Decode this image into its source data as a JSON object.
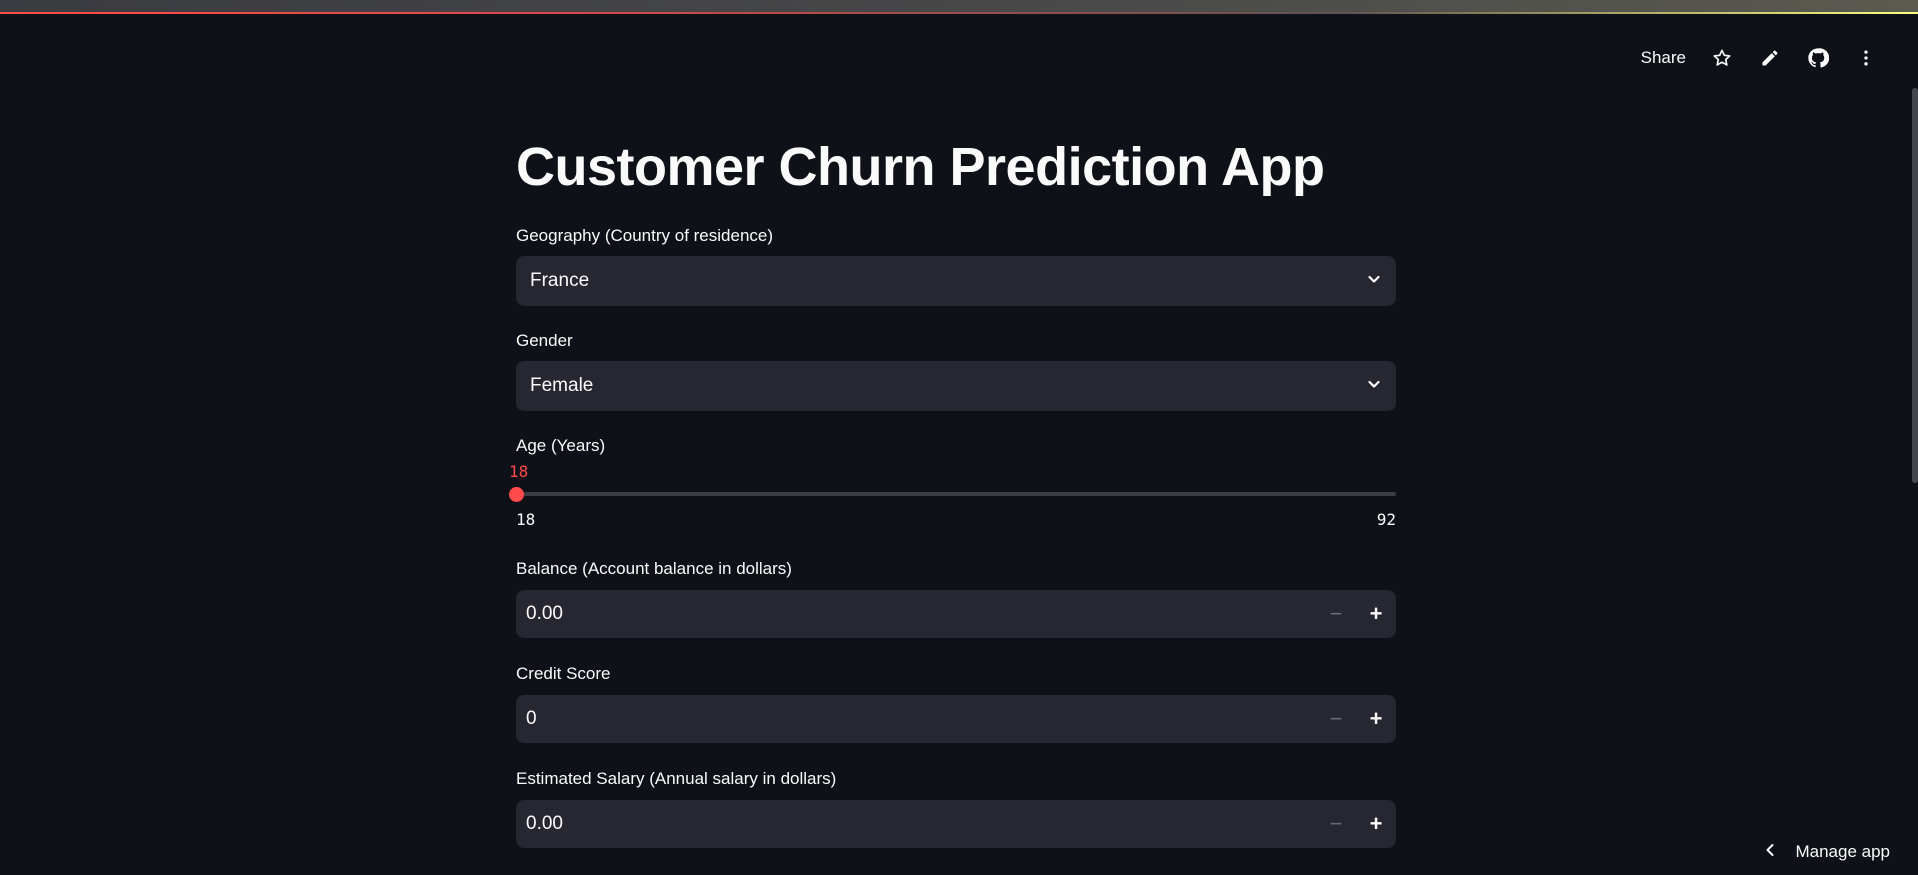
{
  "header": {
    "share_label": "Share",
    "icons": [
      "star-icon",
      "pencil-icon",
      "github-icon",
      "more-vertical-icon"
    ]
  },
  "main": {
    "title": "Customer Churn Prediction App",
    "geography": {
      "label": "Geography (Country of residence)",
      "value": "France"
    },
    "gender": {
      "label": "Gender",
      "value": "Female"
    },
    "age": {
      "label": "Age (Years)",
      "value": "18",
      "min": "18",
      "max": "92"
    },
    "balance": {
      "label": "Balance (Account balance in dollars)",
      "value": "0.00"
    },
    "credit_score": {
      "label": "Credit Score",
      "value": "0"
    },
    "salary": {
      "label": "Estimated Salary (Annual salary in dollars)",
      "value": "0.00"
    },
    "stepper": {
      "minus": "−",
      "plus": "+"
    }
  },
  "footer": {
    "manage_label": "Manage app"
  },
  "colors": {
    "background": "#0e1117",
    "input_bg": "#262730",
    "accent": "#ff4b4b"
  }
}
